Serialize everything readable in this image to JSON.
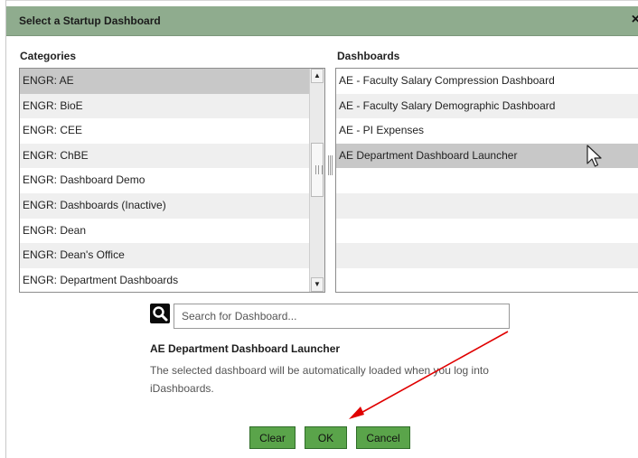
{
  "dialog": {
    "title": "Select a Startup Dashboard",
    "close_symbol": "×"
  },
  "categories": {
    "label": "Categories",
    "items": [
      "ENGR: AE",
      "ENGR: BioE",
      "ENGR: CEE",
      "ENGR: ChBE",
      "ENGR: Dashboard Demo",
      "ENGR: Dashboards (Inactive)",
      "ENGR: Dean",
      "ENGR: Dean's Office",
      "ENGR: Department Dashboards"
    ],
    "selected_index": 0
  },
  "dashboards": {
    "label": "Dashboards",
    "items": [
      "AE - Faculty Salary Compression Dashboard",
      "AE - Faculty Salary Demographic Dashboard",
      "AE - PI Expenses",
      "AE Department Dashboard Launcher"
    ],
    "selected_index": 3
  },
  "search": {
    "placeholder": "Search for Dashboard...",
    "value": ""
  },
  "selection": {
    "title": "AE Department Dashboard Launcher",
    "description": "The selected dashboard will be automatically loaded when you log into iDashboards."
  },
  "buttons": {
    "clear": "Clear",
    "ok": "OK",
    "cancel": "Cancel"
  },
  "icons": {
    "search": "magnifier-icon",
    "cursor": "mouse-pointer-icon",
    "annotation": "red-arrow-icon"
  },
  "colors": {
    "titlebar": "#8fac8e",
    "button_green": "#5aa44a",
    "selected_row": "#c8c8c8",
    "annotation_red": "#e00000"
  }
}
